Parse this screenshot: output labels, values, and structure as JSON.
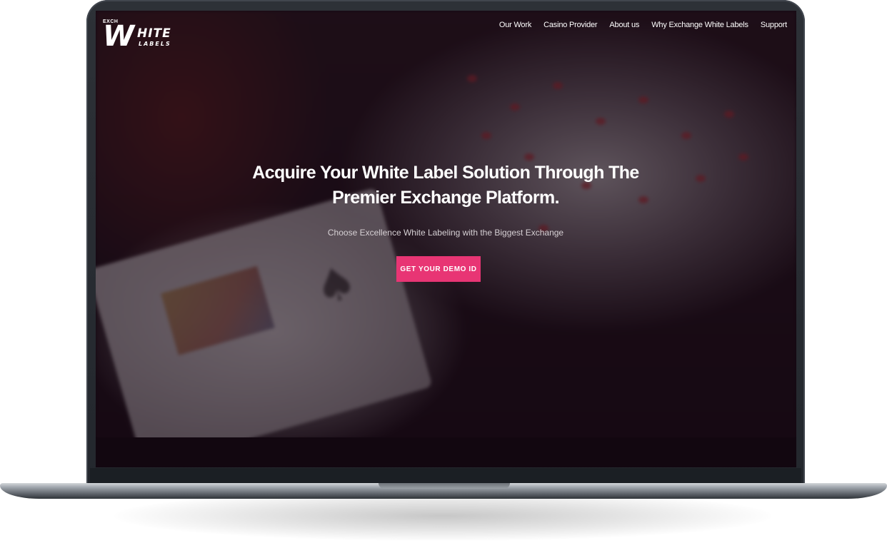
{
  "brand": {
    "logo_prefix": "EXCH",
    "logo_letter": "W",
    "logo_word": "HITE",
    "logo_subword": "LABELS"
  },
  "nav": {
    "items": [
      {
        "label": "Our Work"
      },
      {
        "label": "Casino Provider"
      },
      {
        "label": "About us"
      },
      {
        "label": "Why Exchange White Labels"
      },
      {
        "label": "Support"
      }
    ]
  },
  "hero": {
    "title": "Acquire Your White Label Solution Through The Premier Exchange Platform.",
    "subtitle": "Choose Excellence White Labeling with the Biggest Exchange",
    "cta_label": "GET YOUR DEMO ID"
  },
  "colors": {
    "accent": "#e83574",
    "overlay": "#140610",
    "device_frame": "#2d3137"
  }
}
